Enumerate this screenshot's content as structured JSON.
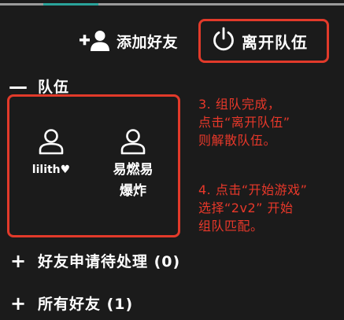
{
  "header": {
    "add_friend_label": "添加好友",
    "leave_team_label": "离开队伍"
  },
  "team_section": {
    "sign": "—",
    "title": "队伍",
    "members": [
      {
        "name": "lilith♥"
      },
      {
        "name_line1": "易燃易",
        "name_line2": "爆炸"
      }
    ]
  },
  "friend_requests": {
    "sign": "+",
    "title": "好友申请待处理 (0)"
  },
  "all_friends": {
    "sign": "+",
    "title": "所有好友 (1)"
  },
  "annotations": {
    "step3": [
      "3. 组队完成，",
      "点击“离开队伍”",
      "则解散队伍。"
    ],
    "step4": [
      "4. 点击“开始游戏”",
      "选择“2v2” 开始",
      "组队匹配。"
    ]
  },
  "colors": {
    "background": "#1b1b1b",
    "highlight": "#e23a2a",
    "annotation_text": "#e8382a",
    "tab_accent": "#2aa39a"
  },
  "icons": [
    "add-friend-icon",
    "power-icon",
    "user-icon"
  ]
}
